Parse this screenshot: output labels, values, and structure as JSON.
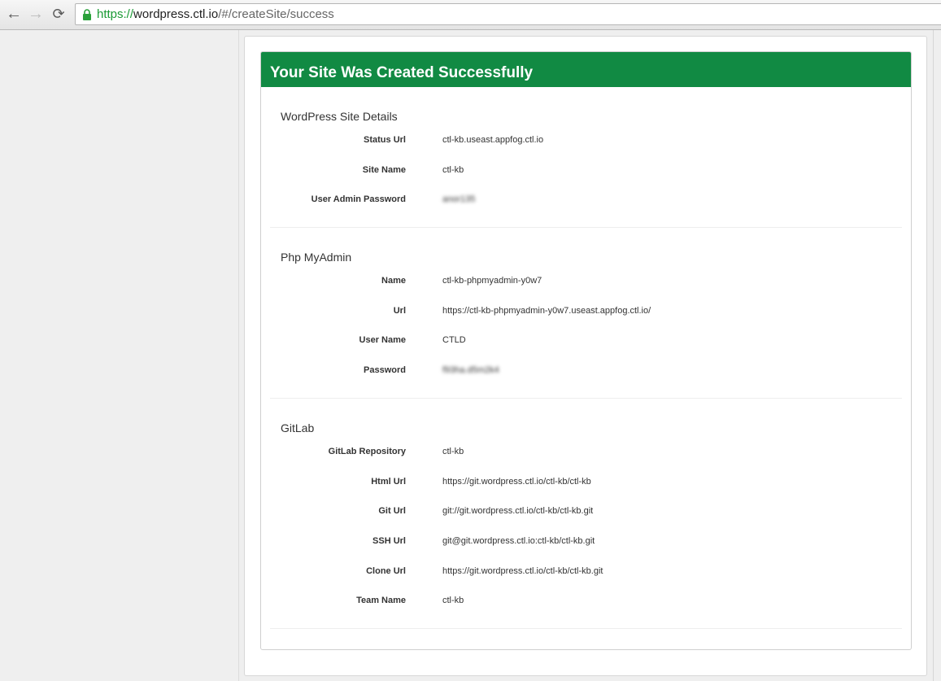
{
  "browser": {
    "url_scheme": "https://",
    "url_host": "wordpress.ctl.io",
    "url_path": "/#/createSite/success"
  },
  "colors": {
    "header": "#118a43",
    "scheme": "#1a9a34"
  },
  "panel": {
    "title": "Your Site Was Created Successfully",
    "sections": [
      {
        "title": "WordPress Site Details",
        "rows": [
          {
            "label": "Status Url",
            "value": "ctl-kb.useast.appfog.ctl.io"
          },
          {
            "label": "Site Name",
            "value": "ctl-kb"
          },
          {
            "label": "User Admin Password",
            "value": "anor135"
          }
        ]
      },
      {
        "title": "Php MyAdmin",
        "rows": [
          {
            "label": "Name",
            "value": "ctl-kb-phpmyadmin-y0w7"
          },
          {
            "label": "Url",
            "value": "https://ctl-kb-phpmyadmin-y0w7.useast.appfog.ctl.io/"
          },
          {
            "label": "User Name",
            "value": "CTLD"
          },
          {
            "label": "Password",
            "value": "f93ha.d5m2k4"
          }
        ]
      },
      {
        "title": "GitLab",
        "rows": [
          {
            "label": "GitLab Repository",
            "value": "ctl-kb"
          },
          {
            "label": "Html Url",
            "value": "https://git.wordpress.ctl.io/ctl-kb/ctl-kb"
          },
          {
            "label": "Git Url",
            "value": "git://git.wordpress.ctl.io/ctl-kb/ctl-kb.git"
          },
          {
            "label": "SSH Url",
            "value": "git@git.wordpress.ctl.io:ctl-kb/ctl-kb.git"
          },
          {
            "label": "Clone Url",
            "value": "https://git.wordpress.ctl.io/ctl-kb/ctl-kb.git"
          },
          {
            "label": "Team Name",
            "value": "ctl-kb"
          }
        ]
      }
    ]
  }
}
